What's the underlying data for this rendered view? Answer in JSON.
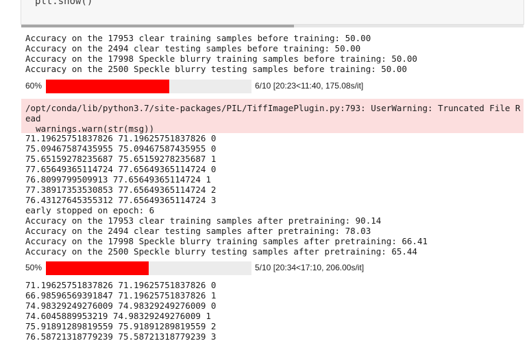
{
  "code_cell": {
    "line": "plt.show()"
  },
  "output": {
    "block1": [
      "Accuracy on the 17953 clear training samples before training: 50.00",
      "Accuracy on the 2494 clear testing samples before training: 50.00",
      "Accuracy on the 17998 Speckle blurry training samples before training: 50.00",
      "Accuracy on the 2500 Speckle blurry testing samples before training: 50.00"
    ],
    "progress1": {
      "percent_label": "60%",
      "fraction": 0.6,
      "stats": "6/10 [20:23<11:40, 175.08s/it]"
    },
    "warning": {
      "line1": "/opt/conda/lib/python3.7/site-packages/PIL/TiffImagePlugin.py:793: UserWarning: Truncated File Read",
      "line2": "  warnings.warn(str(msg))"
    },
    "block2": [
      "71.19625751837826 71.19625751837826 0",
      "75.09467587435955 75.09467587435955 0",
      "75.65159278235687 75.65159278235687 1",
      "77.65649365114724 77.65649365114724 0",
      "76.8099799509913 77.65649365114724 1",
      "77.38917353530853 77.65649365114724 2",
      "76.43127645355312 77.65649365114724 3",
      "early stopped on epoch: 6",
      "Accuracy on the 17953 clear training samples after pretraining: 90.14",
      "Accuracy on the 2494 clear testing samples after pretraining: 78.03",
      "Accuracy on the 17998 Speckle blurry training samples after pretraining: 66.41",
      "Accuracy on the 2500 Speckle blurry testing samples after pretraining: 65.44"
    ],
    "progress2": {
      "percent_label": "50%",
      "fraction": 0.5,
      "stats": "5/10 [20:34<17:10, 206.00s/it]"
    },
    "block3": [
      "71.19625751837826 71.19625751837826 0",
      "66.98596569391847 71.19625751837826 1",
      "74.98329249276009 74.98329249276009 0",
      "74.6045889953219 74.98329249276009 1",
      "75.91891289819559 75.91891289819559 2",
      "76.58721318779239 75.58721318779239 3"
    ]
  },
  "colors": {
    "progress_fill": "#ff0000",
    "progress_track": "#ececec",
    "warning_background": "#fcdede"
  }
}
